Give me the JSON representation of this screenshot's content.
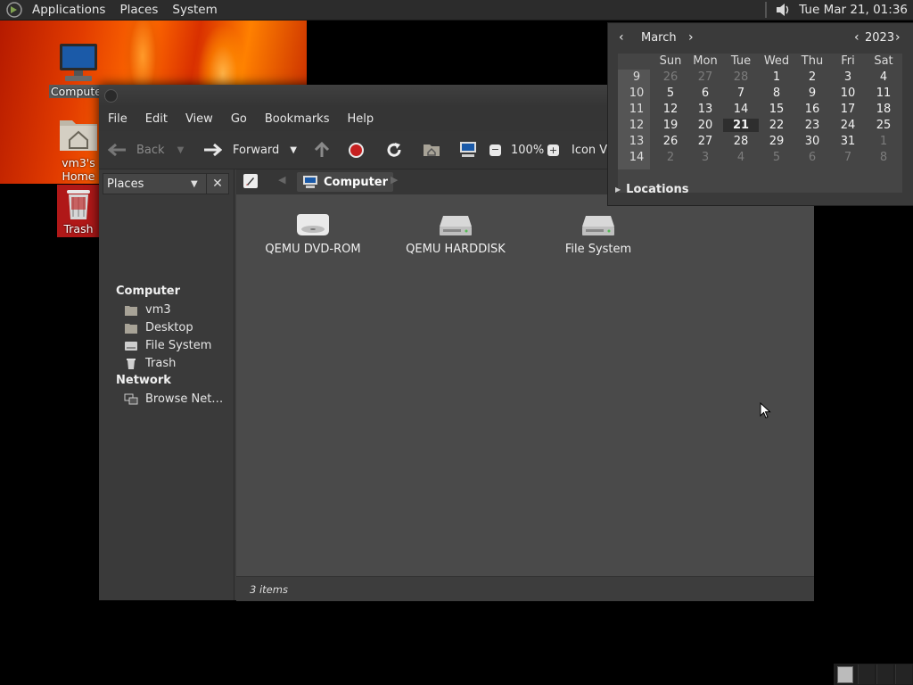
{
  "top_panel": {
    "menus": [
      "Applications",
      "Places",
      "System"
    ],
    "clock": "Tue Mar 21, 01:36",
    "volume_icon": "speaker-icon"
  },
  "desktop": {
    "icons": [
      {
        "label": "Computer",
        "icon": "computer-icon"
      },
      {
        "label": "vm3's Home",
        "icon": "home-folder-icon"
      },
      {
        "label": "Trash",
        "icon": "trash-icon"
      }
    ]
  },
  "file_manager": {
    "menubar": [
      "File",
      "Edit",
      "View",
      "Go",
      "Bookmarks",
      "Help"
    ],
    "toolbar": {
      "back_label": "Back",
      "forward_label": "Forward",
      "zoom_level": "100%",
      "view_mode": "Icon View"
    },
    "sidebar": {
      "selector_label": "Places",
      "sections": [
        {
          "title": "Computer",
          "items": [
            "vm3",
            "Desktop",
            "File System",
            "Trash"
          ]
        },
        {
          "title": "Network",
          "items": [
            "Browse Net…"
          ]
        }
      ]
    },
    "location": {
      "crumb": "Computer"
    },
    "items": [
      {
        "label": "QEMU DVD-ROM",
        "icon": "optical-drive-icon"
      },
      {
        "label": "QEMU HARDDISK",
        "icon": "hard-disk-icon"
      },
      {
        "label": "File System",
        "icon": "hard-disk-icon"
      }
    ],
    "status": "3 items"
  },
  "calendar": {
    "month": "March",
    "year": "2023",
    "weekdays": [
      "Sun",
      "Mon",
      "Tue",
      "Wed",
      "Thu",
      "Fri",
      "Sat"
    ],
    "weeks": [
      {
        "num": "9",
        "days": [
          "26",
          "27",
          "28",
          "1",
          "2",
          "3",
          "4"
        ]
      },
      {
        "num": "10",
        "days": [
          "5",
          "6",
          "7",
          "8",
          "9",
          "10",
          "11"
        ]
      },
      {
        "num": "11",
        "days": [
          "12",
          "13",
          "14",
          "15",
          "16",
          "17",
          "18"
        ]
      },
      {
        "num": "12",
        "days": [
          "19",
          "20",
          "21",
          "22",
          "23",
          "24",
          "25"
        ]
      },
      {
        "num": "13",
        "days": [
          "26",
          "27",
          "28",
          "29",
          "30",
          "31",
          "1"
        ]
      },
      {
        "num": "14",
        "days": [
          "2",
          "3",
          "4",
          "5",
          "6",
          "7",
          "8"
        ]
      }
    ],
    "today": "21",
    "locations_label": "Locations"
  },
  "colors": {
    "panel": "#2c2c2c",
    "window_bg": "#3c3c3c",
    "content_bg": "#4a4a4a",
    "stop_red": "#c62020"
  }
}
